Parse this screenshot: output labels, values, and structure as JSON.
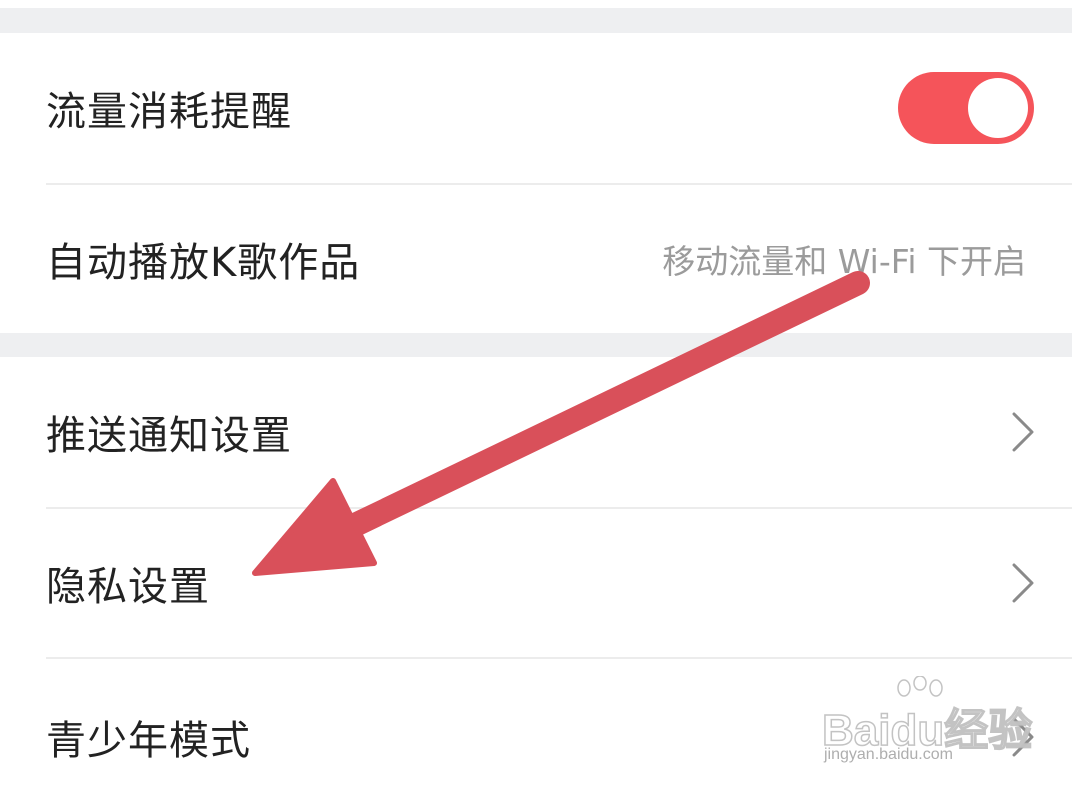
{
  "settings": {
    "section1": [
      {
        "label": "流量消耗提醒",
        "control": "toggle",
        "toggle_on": true
      },
      {
        "label": "自动播放K歌作品",
        "value": "移动流量和 Wi-Fi 下开启"
      }
    ],
    "section2": [
      {
        "label": "推送通知设置",
        "icon": "chevron-right-icon"
      },
      {
        "label": "隐私设置",
        "icon": "chevron-right-icon"
      },
      {
        "label": "青少年模式",
        "icon": "chevron-right-icon"
      }
    ]
  },
  "colors": {
    "toggle_on": "#f5545a",
    "annotation_arrow": "#d9505a",
    "section_gap": "#eeeff1"
  },
  "annotation": {
    "type": "arrow",
    "icon": "arrow-annotation-icon",
    "points_to": "隐私设置"
  },
  "watermark": {
    "brand_logo": "Baidu经验",
    "url": "jingyan.baidu.com"
  }
}
